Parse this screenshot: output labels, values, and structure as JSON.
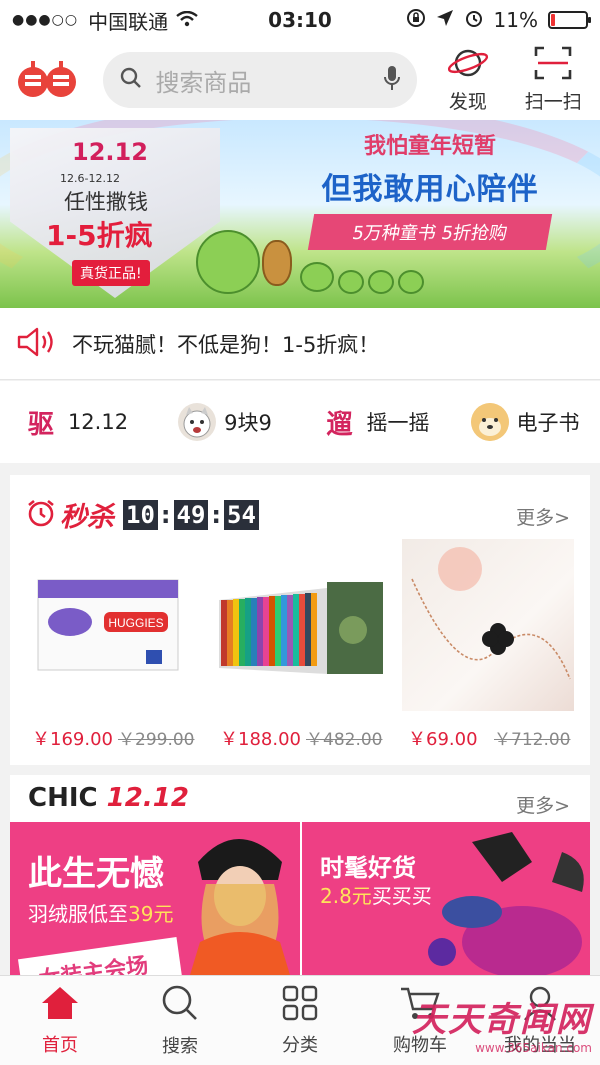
{
  "status_bar": {
    "signal": "●●●○○",
    "carrier": "中国联通",
    "time": "03:10",
    "battery_text": "11%",
    "battery_level": 0.11
  },
  "header": {
    "logo_text": "当当",
    "search_placeholder": "搜索商品",
    "discover_label": "发现",
    "scan_label": "扫一扫"
  },
  "banner": {
    "left": {
      "date_big": "12.12",
      "date_range": "12.6-12.12",
      "line1": "任性撒钱",
      "line2": "1-5折疯",
      "badge": "真货正品!"
    },
    "right": {
      "line1": "我怕童年短暂",
      "line2": "但我敢用心陪伴",
      "line3": "5万种童书 5折抢购"
    }
  },
  "notice": {
    "text": "不玩猫腻！不低是狗！1-5折疯！"
  },
  "shortcuts": [
    {
      "icon_text": "驱",
      "label": "12.12"
    },
    {
      "icon_text": "",
      "label": "9块9"
    },
    {
      "icon_text": "遛",
      "label": "摇一摇"
    },
    {
      "icon_text": "",
      "label": "电子书"
    }
  ],
  "flash_sale": {
    "title": "秒杀",
    "countdown": [
      "10",
      "49",
      "54"
    ],
    "more": "更多>",
    "products": [
      {
        "name": "HUGGIES",
        "price": "￥169.00",
        "original": "￥299.00"
      },
      {
        "name": "",
        "price": "￥188.00",
        "original": "￥482.00"
      },
      {
        "name": "",
        "price": "￥69.00",
        "original": "￥712.00"
      }
    ]
  },
  "chic": {
    "title_a": "CHIC",
    "title_b": "12.12",
    "more": "更多>",
    "tiles": [
      {
        "big": "此生无憾",
        "small_a": "羽绒服低至",
        "small_b": "39元",
        "extra": "女装主会场"
      },
      {
        "big": "时髦好货",
        "small_a": "",
        "small_b": "2.8元",
        "small_c": "买买买"
      }
    ]
  },
  "tabbar": {
    "tabs": [
      {
        "label": "首页",
        "active": true
      },
      {
        "label": "搜索",
        "active": false
      },
      {
        "label": "分类",
        "active": false
      },
      {
        "label": "购物车",
        "active": false
      },
      {
        "label": "我的当当",
        "active": false
      }
    ]
  },
  "watermark": {
    "line1": "天天奇闻网",
    "line2": "www.365aikan.com"
  },
  "colors": {
    "accent": "#e0203c",
    "pink": "#ee3f84",
    "countdown_bg": "#2a2f3a"
  }
}
